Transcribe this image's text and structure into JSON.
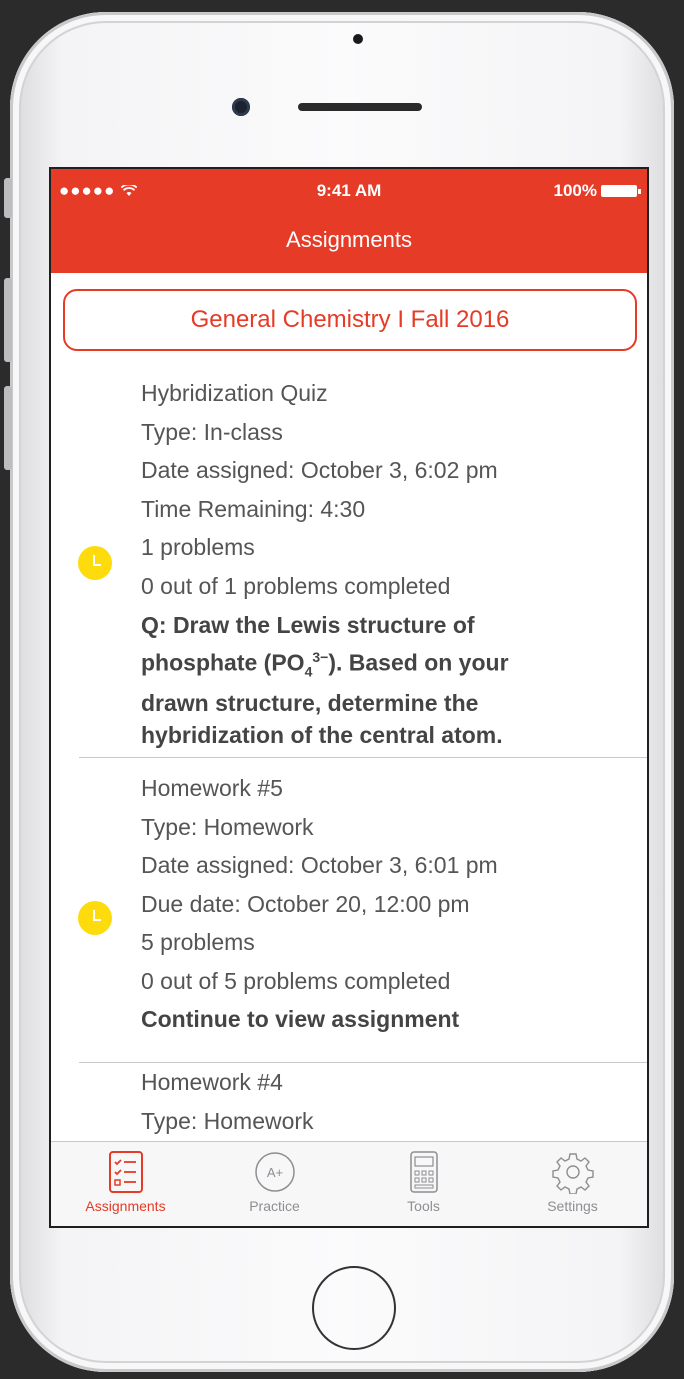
{
  "status_bar": {
    "signal": "●●●●● ",
    "time": "9:41 AM",
    "battery": "100%"
  },
  "nav": {
    "title": "Assignments"
  },
  "course": {
    "label": "General Chemistry I Fall 2016"
  },
  "assignments": [
    {
      "title": "Hybridization Quiz",
      "type": "Type: In-class",
      "date_assigned": "Date assigned: October 3, 6:02 pm",
      "time_info": "Time Remaining: 4:30",
      "problems": "1 problems",
      "completed": "0 out of 1 problems completed",
      "question_prefix": "Q: Draw the Lewis structure of phosphate (PO",
      "question_sub": "4",
      "question_sup": "3−",
      "question_suffix": "). Based on your drawn structure, determine the hybridization of the central atom."
    },
    {
      "title": "Homework #5",
      "type": "Type: Homework",
      "date_assigned": "Date assigned: October 3, 6:01 pm",
      "time_info": "Due date: October 20, 12:00 pm",
      "problems": "5 problems",
      "completed": "0 out of 5 problems completed",
      "action": "Continue to view assignment"
    },
    {
      "title": "Homework #4",
      "type": "Type: Homework"
    }
  ],
  "tabs": [
    {
      "label": "Assignments",
      "icon": "checklist-icon",
      "active": true
    },
    {
      "label": "Practice",
      "icon": "a-plus-icon",
      "active": false
    },
    {
      "label": "Tools",
      "icon": "calculator-icon",
      "active": false
    },
    {
      "label": "Settings",
      "icon": "gear-icon",
      "active": false
    }
  ],
  "colors": {
    "accent": "#e53b27",
    "clock": "#fedb0d"
  }
}
